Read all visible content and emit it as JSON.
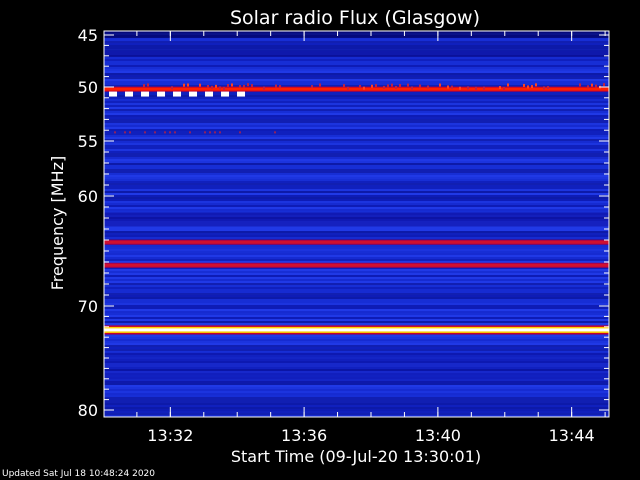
{
  "chart_data": {
    "type": "heatmap",
    "title": "Solar radio Flux (Glasgow)",
    "xlabel": "Start Time (09-Jul-20 13:30:01)",
    "ylabel": "Frequency [MHz]",
    "x_ticks": [
      "13:32",
      "13:36",
      "13:40",
      "13:44"
    ],
    "x_minor_step_minutes": 1,
    "xlim": [
      "13:30:01",
      "13:45:07"
    ],
    "y_ticks": [
      45,
      50,
      55,
      60,
      70,
      80
    ],
    "y_minor_ticks": [
      46,
      47,
      48,
      49,
      51,
      52,
      53,
      54,
      56,
      57,
      58,
      59,
      61,
      62,
      63,
      64,
      65,
      66,
      67,
      68,
      69,
      71,
      72,
      73,
      74,
      75,
      76,
      77,
      78,
      79
    ],
    "ylim": [
      44.5,
      80
    ],
    "y_axis_inverted": true,
    "y_scale": "nonlinear (frequency increases downward, compressed at high end)",
    "colormap": [
      "#000000",
      "#0000a0",
      "#1a3cff",
      "#c00040",
      "#ff2000",
      "#ffd000",
      "#ffffff"
    ],
    "strong_emission_bands_mhz": [
      {
        "freq": 50.2,
        "intensity": "medium-high",
        "note": "intermittent red band 13:31–13:45"
      },
      {
        "freq": 64.2,
        "intensity": "medium"
      },
      {
        "freq": 66.3,
        "intensity": "medium"
      },
      {
        "freq": 72.3,
        "intensity": "saturated",
        "note": "continuous bright white/yellow line"
      }
    ],
    "markers": {
      "freq": 50.7,
      "start": "13:30:10",
      "end": "13:34:05",
      "style": "white dashed"
    }
  },
  "footer": "Updated Sat Jul 18 10:48:24 2020"
}
